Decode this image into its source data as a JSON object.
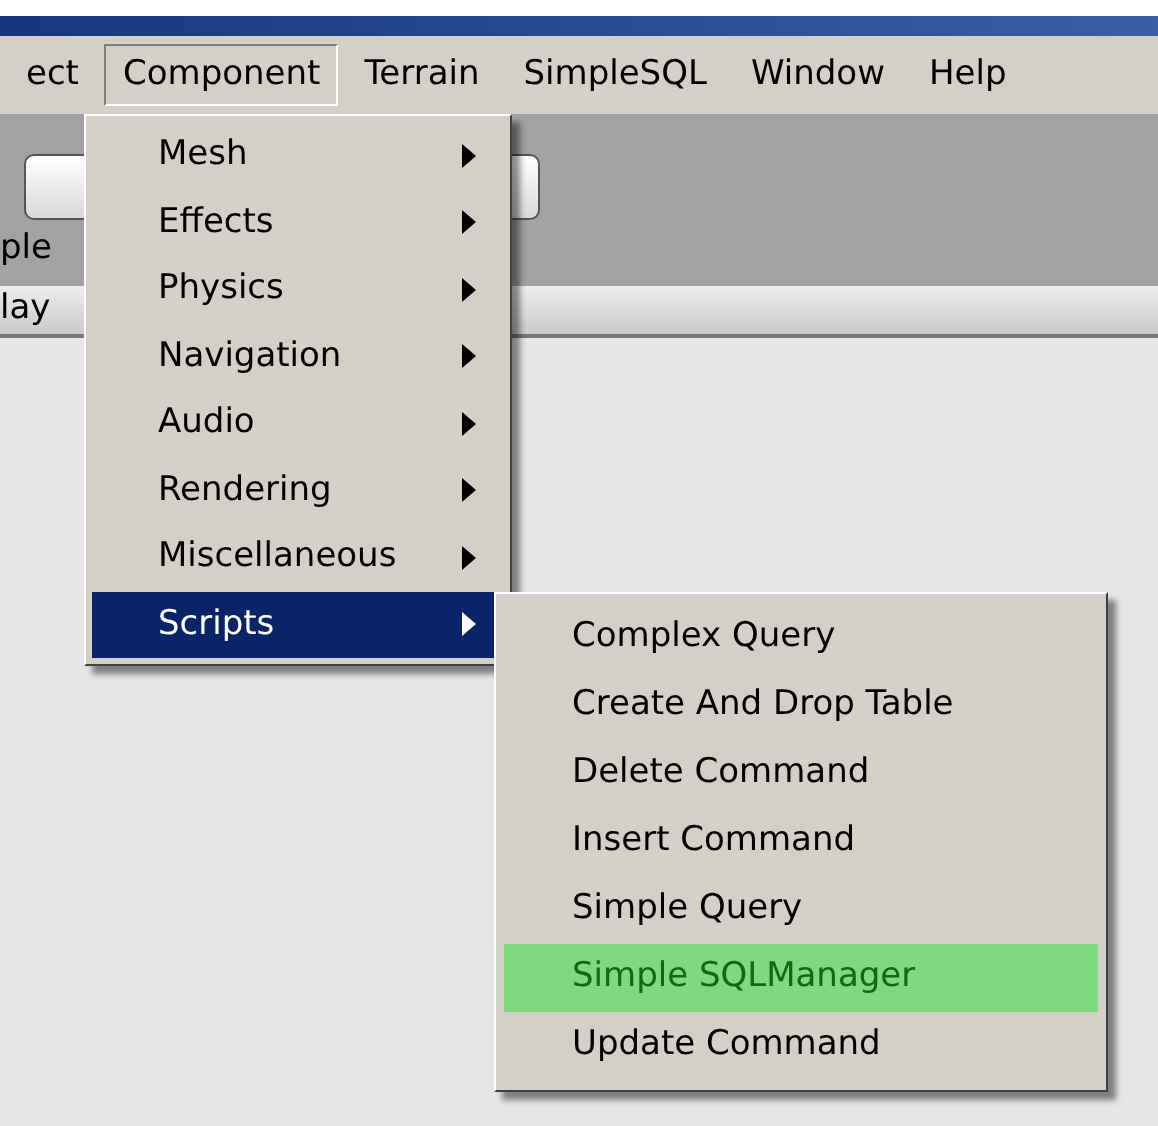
{
  "menu_bar": [
    {
      "label": "ect",
      "selected": false
    },
    {
      "label": "Component",
      "selected": true
    },
    {
      "label": "Terrain",
      "selected": false
    },
    {
      "label": "SimpleSQL",
      "selected": false
    },
    {
      "label": "Window",
      "selected": false
    },
    {
      "label": "Help",
      "selected": false
    }
  ],
  "side_labels": [
    "ple",
    "lay"
  ],
  "component_menu": {
    "items": [
      {
        "label": "Mesh",
        "selected": false
      },
      {
        "label": "Effects",
        "selected": false
      },
      {
        "label": "Physics",
        "selected": false
      },
      {
        "label": "Navigation",
        "selected": false
      },
      {
        "label": "Audio",
        "selected": false
      },
      {
        "label": "Rendering",
        "selected": false
      },
      {
        "label": "Miscellaneous",
        "selected": false
      },
      {
        "label": "Scripts",
        "selected": true
      }
    ]
  },
  "scripts_submenu": {
    "items": [
      {
        "label": "Complex Query",
        "selected": false
      },
      {
        "label": "Create And Drop Table",
        "selected": false
      },
      {
        "label": "Delete Command",
        "selected": false
      },
      {
        "label": "Insert Command",
        "selected": false
      },
      {
        "label": "Simple Query",
        "selected": false
      },
      {
        "label": "Simple SQLManager",
        "selected": true
      },
      {
        "label": "Update Command",
        "selected": false
      }
    ]
  }
}
